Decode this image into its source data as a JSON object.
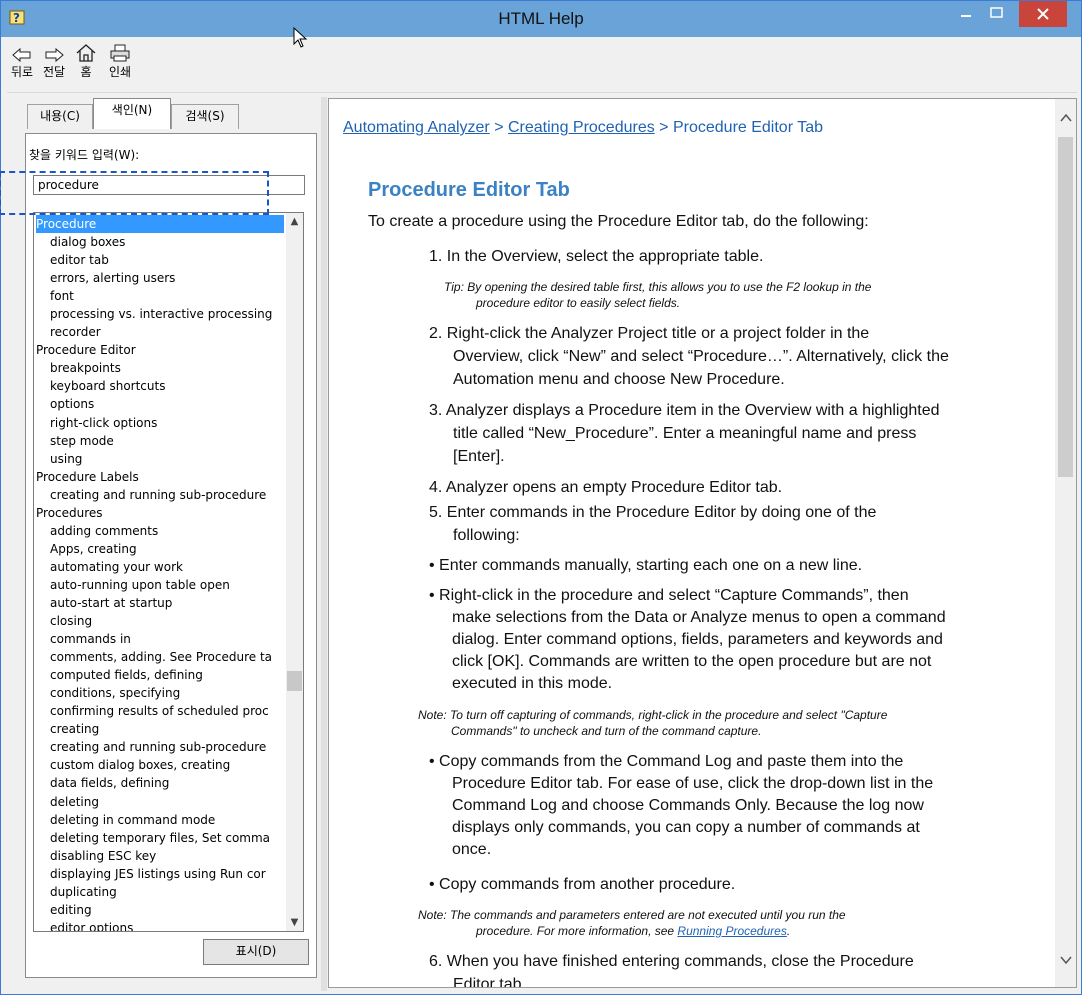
{
  "window": {
    "title": "HTML Help"
  },
  "toolbar": {
    "back": "뒤로",
    "forward": "전달",
    "home": "홈",
    "print": "인쇄"
  },
  "left": {
    "tabs": [
      "내용(C)",
      "색인(N)",
      "검색(S)"
    ],
    "keyword_label": "찾을 키워드 입력(W):",
    "keyword_value": "procedure",
    "display_button": "표시(D)",
    "items": [
      {
        "text": "Procedure",
        "level": 0,
        "selected": true
      },
      {
        "text": "dialog boxes",
        "level": 1
      },
      {
        "text": "editor tab",
        "level": 1
      },
      {
        "text": "errors, alerting users",
        "level": 1
      },
      {
        "text": "font",
        "level": 1
      },
      {
        "text": "processing vs. interactive processing",
        "level": 1
      },
      {
        "text": "recorder",
        "level": 1
      },
      {
        "text": "Procedure Editor",
        "level": 0
      },
      {
        "text": "breakpoints",
        "level": 1
      },
      {
        "text": "keyboard shortcuts",
        "level": 1
      },
      {
        "text": "options",
        "level": 1
      },
      {
        "text": "right-click options",
        "level": 1
      },
      {
        "text": "step mode",
        "level": 1
      },
      {
        "text": "using",
        "level": 1
      },
      {
        "text": "Procedure Labels",
        "level": 0
      },
      {
        "text": "creating and running sub-procedure",
        "level": 1
      },
      {
        "text": "Procedures",
        "level": 0
      },
      {
        "text": "adding comments",
        "level": 1
      },
      {
        "text": "Apps, creating",
        "level": 1
      },
      {
        "text": "automating your work",
        "level": 1
      },
      {
        "text": "auto-running upon table open",
        "level": 1
      },
      {
        "text": "auto-start at startup",
        "level": 1
      },
      {
        "text": "closing",
        "level": 1
      },
      {
        "text": "commands in",
        "level": 1
      },
      {
        "text": "comments, adding. See Procedure ta",
        "level": 1
      },
      {
        "text": "computed fields, defining",
        "level": 1
      },
      {
        "text": "conditions, specifying",
        "level": 1
      },
      {
        "text": "confirming results of scheduled proc",
        "level": 1
      },
      {
        "text": "creating",
        "level": 1
      },
      {
        "text": "creating and running sub-procedure",
        "level": 1
      },
      {
        "text": "custom dialog boxes, creating",
        "level": 1
      },
      {
        "text": "data fields, defining",
        "level": 1
      },
      {
        "text": "deleting",
        "level": 1
      },
      {
        "text": "deleting in command mode",
        "level": 1
      },
      {
        "text": "deleting temporary files, Set comma",
        "level": 1
      },
      {
        "text": "disabling ESC key",
        "level": 1
      },
      {
        "text": "displaying JES listings using Run cor",
        "level": 1
      },
      {
        "text": "duplicating",
        "level": 1
      },
      {
        "text": "editing",
        "level": 1
      },
      {
        "text": "editor options",
        "level": 1
      }
    ]
  },
  "content": {
    "breadcrumb": {
      "link1": "Automating Analyzer",
      "sep1": " > ",
      "link2": "Creating Procedures",
      "sep2": " > ",
      "current": "Procedure Editor Tab"
    },
    "heading": "Procedure Editor Tab",
    "intro": "To create a procedure using the Procedure Editor tab, do the following:",
    "step1": "1. In the Overview, select the appropriate table.",
    "tip_line1": "Tip: By opening the desired table first, this allows you to use the F2 lookup in the",
    "tip_line2": "procedure editor to easily select fields.",
    "step2_l1": "2. Right-click the Analyzer Project title or a project folder in the",
    "step2_l2": "Overview, click “New” and select “Procedure…”. Alternatively, click the",
    "step2_l3": "Automation menu and choose New Procedure.",
    "step3_l1": "3. Analyzer displays a Procedure item in the Overview with a highlighted",
    "step3_l2": "title called “New_Procedure”. Enter a meaningful name and press",
    "step3_l3": "[Enter].",
    "step4": "4. Analyzer opens an empty Procedure Editor tab.",
    "step5_l1": "5. Enter commands in the Procedure Editor by doing one of the",
    "step5_l2": "following:",
    "bullet1": "• Enter commands manually, starting each one on a new line.",
    "bullet2_l1": "• Right-click in the procedure and select “Capture Commands”, then",
    "bullet2_l2": "make selections from the Data or Analyze menus to open a command",
    "bullet2_l3": "dialog. Enter command options, fields, parameters and keywords and",
    "bullet2_l4": "click [OK]. Commands are written to the open procedure but are not",
    "bullet2_l5": "executed in this mode.",
    "note1_l1": "Note: To turn off capturing of commands, right-click in the procedure and select \"Capture",
    "note1_l2": "Commands\" to uncheck and turn of the command capture.",
    "bullet3_l1": "• Copy commands from the Command Log and paste them into the",
    "bullet3_l2": "Procedure Editor tab. For ease of use, click the drop-down list in the",
    "bullet3_l3": "Command Log and choose Commands Only. Because the log now",
    "bullet3_l4": "displays only commands, you can copy a number of commands at",
    "bullet3_l5": "once.",
    "bullet4": "• Copy commands from another procedure.",
    "note2_l1": "Note: The commands and parameters entered are not executed until you run the",
    "note2_l2a": "procedure. For more information, see ",
    "note2_link": "Running Procedures",
    "note2_l2b": ".",
    "step6_l1": "6. When you have finished entering commands, close the Procedure",
    "step6_l2": "Editor tab."
  }
}
